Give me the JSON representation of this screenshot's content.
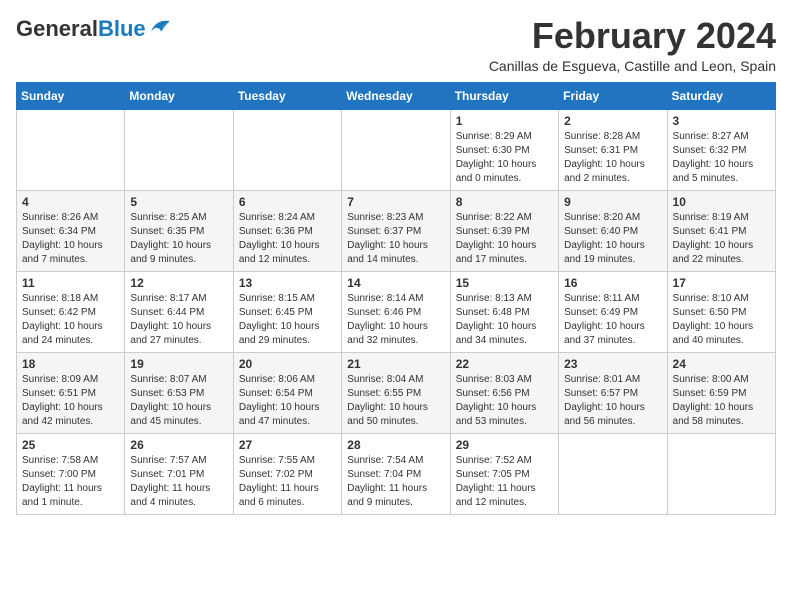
{
  "logo": {
    "general": "General",
    "blue": "Blue"
  },
  "header": {
    "month": "February 2024",
    "location": "Canillas de Esgueva, Castille and Leon, Spain"
  },
  "weekdays": [
    "Sunday",
    "Monday",
    "Tuesday",
    "Wednesday",
    "Thursday",
    "Friday",
    "Saturday"
  ],
  "weeks": [
    [
      {
        "day": "",
        "info": ""
      },
      {
        "day": "",
        "info": ""
      },
      {
        "day": "",
        "info": ""
      },
      {
        "day": "",
        "info": ""
      },
      {
        "day": "1",
        "info": "Sunrise: 8:29 AM\nSunset: 6:30 PM\nDaylight: 10 hours\nand 0 minutes."
      },
      {
        "day": "2",
        "info": "Sunrise: 8:28 AM\nSunset: 6:31 PM\nDaylight: 10 hours\nand 2 minutes."
      },
      {
        "day": "3",
        "info": "Sunrise: 8:27 AM\nSunset: 6:32 PM\nDaylight: 10 hours\nand 5 minutes."
      }
    ],
    [
      {
        "day": "4",
        "info": "Sunrise: 8:26 AM\nSunset: 6:34 PM\nDaylight: 10 hours\nand 7 minutes."
      },
      {
        "day": "5",
        "info": "Sunrise: 8:25 AM\nSunset: 6:35 PM\nDaylight: 10 hours\nand 9 minutes."
      },
      {
        "day": "6",
        "info": "Sunrise: 8:24 AM\nSunset: 6:36 PM\nDaylight: 10 hours\nand 12 minutes."
      },
      {
        "day": "7",
        "info": "Sunrise: 8:23 AM\nSunset: 6:37 PM\nDaylight: 10 hours\nand 14 minutes."
      },
      {
        "day": "8",
        "info": "Sunrise: 8:22 AM\nSunset: 6:39 PM\nDaylight: 10 hours\nand 17 minutes."
      },
      {
        "day": "9",
        "info": "Sunrise: 8:20 AM\nSunset: 6:40 PM\nDaylight: 10 hours\nand 19 minutes."
      },
      {
        "day": "10",
        "info": "Sunrise: 8:19 AM\nSunset: 6:41 PM\nDaylight: 10 hours\nand 22 minutes."
      }
    ],
    [
      {
        "day": "11",
        "info": "Sunrise: 8:18 AM\nSunset: 6:42 PM\nDaylight: 10 hours\nand 24 minutes."
      },
      {
        "day": "12",
        "info": "Sunrise: 8:17 AM\nSunset: 6:44 PM\nDaylight: 10 hours\nand 27 minutes."
      },
      {
        "day": "13",
        "info": "Sunrise: 8:15 AM\nSunset: 6:45 PM\nDaylight: 10 hours\nand 29 minutes."
      },
      {
        "day": "14",
        "info": "Sunrise: 8:14 AM\nSunset: 6:46 PM\nDaylight: 10 hours\nand 32 minutes."
      },
      {
        "day": "15",
        "info": "Sunrise: 8:13 AM\nSunset: 6:48 PM\nDaylight: 10 hours\nand 34 minutes."
      },
      {
        "day": "16",
        "info": "Sunrise: 8:11 AM\nSunset: 6:49 PM\nDaylight: 10 hours\nand 37 minutes."
      },
      {
        "day": "17",
        "info": "Sunrise: 8:10 AM\nSunset: 6:50 PM\nDaylight: 10 hours\nand 40 minutes."
      }
    ],
    [
      {
        "day": "18",
        "info": "Sunrise: 8:09 AM\nSunset: 6:51 PM\nDaylight: 10 hours\nand 42 minutes."
      },
      {
        "day": "19",
        "info": "Sunrise: 8:07 AM\nSunset: 6:53 PM\nDaylight: 10 hours\nand 45 minutes."
      },
      {
        "day": "20",
        "info": "Sunrise: 8:06 AM\nSunset: 6:54 PM\nDaylight: 10 hours\nand 47 minutes."
      },
      {
        "day": "21",
        "info": "Sunrise: 8:04 AM\nSunset: 6:55 PM\nDaylight: 10 hours\nand 50 minutes."
      },
      {
        "day": "22",
        "info": "Sunrise: 8:03 AM\nSunset: 6:56 PM\nDaylight: 10 hours\nand 53 minutes."
      },
      {
        "day": "23",
        "info": "Sunrise: 8:01 AM\nSunset: 6:57 PM\nDaylight: 10 hours\nand 56 minutes."
      },
      {
        "day": "24",
        "info": "Sunrise: 8:00 AM\nSunset: 6:59 PM\nDaylight: 10 hours\nand 58 minutes."
      }
    ],
    [
      {
        "day": "25",
        "info": "Sunrise: 7:58 AM\nSunset: 7:00 PM\nDaylight: 11 hours\nand 1 minute."
      },
      {
        "day": "26",
        "info": "Sunrise: 7:57 AM\nSunset: 7:01 PM\nDaylight: 11 hours\nand 4 minutes."
      },
      {
        "day": "27",
        "info": "Sunrise: 7:55 AM\nSunset: 7:02 PM\nDaylight: 11 hours\nand 6 minutes."
      },
      {
        "day": "28",
        "info": "Sunrise: 7:54 AM\nSunset: 7:04 PM\nDaylight: 11 hours\nand 9 minutes."
      },
      {
        "day": "29",
        "info": "Sunrise: 7:52 AM\nSunset: 7:05 PM\nDaylight: 11 hours\nand 12 minutes."
      },
      {
        "day": "",
        "info": ""
      },
      {
        "day": "",
        "info": ""
      }
    ]
  ]
}
